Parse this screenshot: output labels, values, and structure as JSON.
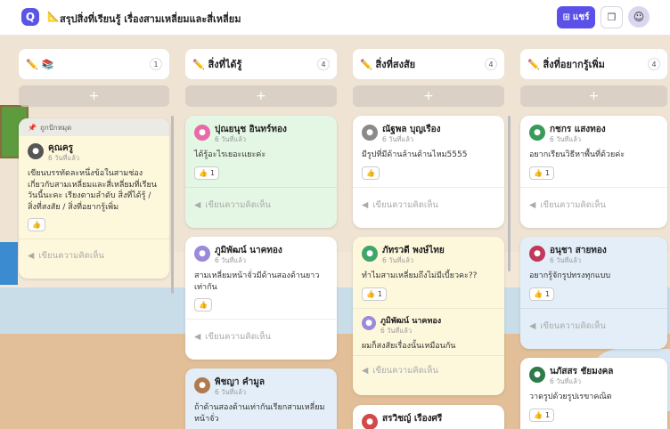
{
  "header": {
    "logo": "Q",
    "title": "สรุปสิ่งที่เรียนรู้ เรื่องสามเหลี่ยมและสี่เหลี่ยม",
    "share_label": "แชร์"
  },
  "columns": [
    {
      "title": "✏️ 📚",
      "count": "1"
    },
    {
      "title": "✏️ สิ่งที่ได้รู้",
      "count": "4"
    },
    {
      "title": "✏️ สิ่งที่สงสัย",
      "count": "4"
    },
    {
      "title": "✏️ สิ่งที่อยากรู้เพิ่ม",
      "count": "4"
    }
  ],
  "add_label": "+",
  "comment_placeholder": "เขียนความคิดเห็น",
  "pinned_label": "ถูกปักหมุด",
  "cards": {
    "c0": {
      "name": "คุณครู",
      "time": "6 วันที่แล้ว",
      "text": "เขียนบรรทัดละหนึ่งข้อในสามช่อง เกี่ยวกับสามเหลี่ยมและสี่เหลี่ยมที่เรียนวันนี้นะคะ เรียงตามลำดับ สิ่งที่ได้รู้ / สิ่งที่สงสัย / สิ่งที่อยากรู้เพิ่ม"
    },
    "c1a": {
      "name": "ปุณยนุช อินทร์ทอง",
      "time": "6 วันที่แล้ว",
      "text": "ได้รู้อะไรเยอะแยะค่ะ",
      "likes": "1"
    },
    "c1b": {
      "name": "ภูมิพัฒน์ นาคทอง",
      "time": "6 วันที่แล้ว",
      "text": "สามเหลี่ยมหน้าจั่วมีด้านสองด้านยาวเท่ากัน"
    },
    "c1c": {
      "name": "พิชญา คำมูล",
      "time": "6 วันที่แล้ว",
      "text": "ถ้าด้านสองด้านเท่ากันเรียกสามเหลี่ยมหน้าจั่ว"
    },
    "c2a": {
      "name": "ณัฐพล บุญเรือง",
      "time": "6 วันที่แล้ว",
      "text": "มีรูปที่มีด้านล้านด้านไหม5555"
    },
    "c2b": {
      "name": "ภัทรวดี พงษ์ไทย",
      "time": "6 วันที่แล้ว",
      "text": "ทำไมสามเหลี่ยมถึงไม่มีเบี้ยวคะ??",
      "likes": "1"
    },
    "c2b_reply": {
      "name": "ภูมิพัฒน์ นาคทอง",
      "time": "6 วันที่แล้ว",
      "text": "ผมก็สงสัยเรื่องนั้นเหมือนกัน"
    },
    "c2c": {
      "name": "สรวิชญ์ เรืองศรี"
    },
    "c3a": {
      "name": "กชกร แสงทอง",
      "time": "6 วันที่แล้ว",
      "text": "อยากเรียนวิธีหาพื้นที่ด้วยค่ะ",
      "likes": "1"
    },
    "c3b": {
      "name": "อนุชา สายทอง",
      "time": "6 วันที่แล้ว",
      "text": "อยากรู้จักรูปทรงทุกแบบ",
      "likes": "1"
    },
    "c3c": {
      "name": "นภัสสร ชัยมงคล",
      "time": "6 วันที่แล้ว",
      "text": "วาดรูปด้วยรูปเรขาคณิต",
      "likes": "1"
    }
  }
}
